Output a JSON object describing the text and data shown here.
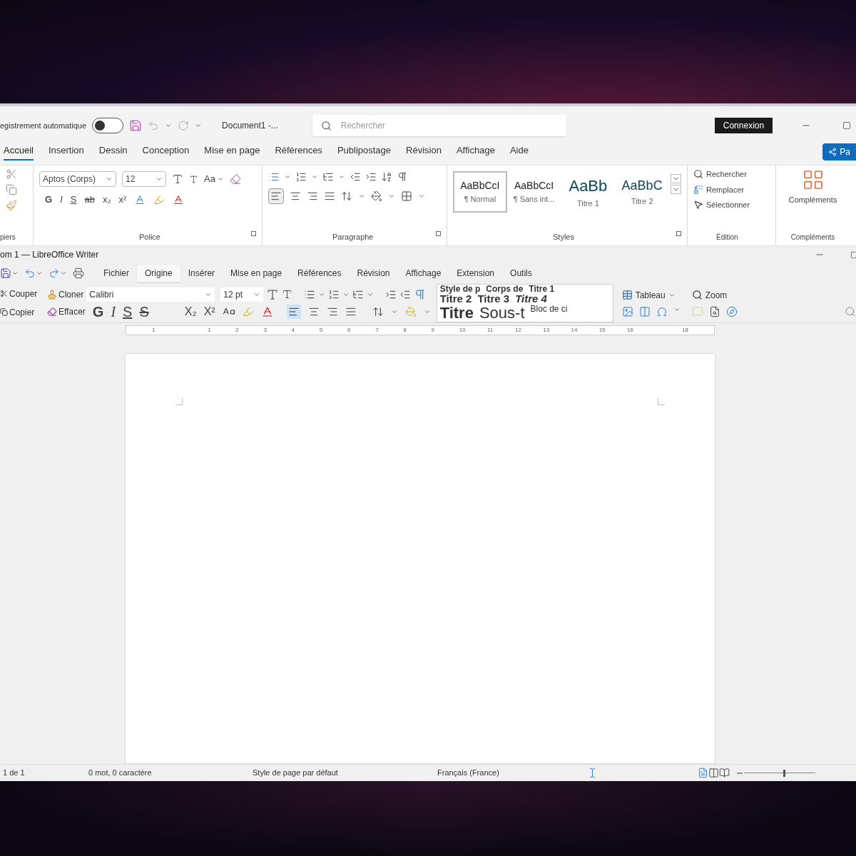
{
  "word": {
    "autosave_label": "egistrement automatique",
    "autosave_on": false,
    "doc_title": "Document1 -...",
    "search_placeholder": "Rechercher",
    "signin": "Connexion",
    "tabs": [
      {
        "label": "Accueil",
        "selected": true
      },
      {
        "label": "Insertion",
        "selected": false
      },
      {
        "label": "Dessin",
        "selected": false
      },
      {
        "label": "Conception",
        "selected": false
      },
      {
        "label": "Mise en page",
        "selected": false
      },
      {
        "label": "Références",
        "selected": false
      },
      {
        "label": "Publipostage",
        "selected": false
      },
      {
        "label": "Révision",
        "selected": false
      },
      {
        "label": "Affichage",
        "selected": false
      },
      {
        "label": "Aide",
        "selected": false
      }
    ],
    "share": "Pa",
    "font": "Aptos (Corps)",
    "size": "12",
    "case_button": "Aa",
    "format_chars": [
      "G",
      "I",
      "S",
      "ab",
      "x₂",
      "x²"
    ],
    "styles": [
      {
        "preview": "AaBbCcI",
        "name": "¶ Normal",
        "kind": "body",
        "selected": true
      },
      {
        "preview": "AaBbCcI",
        "name": "¶ Sans int...",
        "kind": "body",
        "selected": false
      },
      {
        "preview": "AaBb",
        "name": "Titre 1",
        "kind": "heading1",
        "selected": false
      },
      {
        "preview": "AaBbC",
        "name": "Titre 2",
        "kind": "heading2",
        "selected": false
      }
    ],
    "edit": [
      "Rechercher",
      "Remplacer",
      "Sélectionner"
    ],
    "addins": "Compléments",
    "groups": [
      "piers",
      "Police",
      "Paragraphe",
      "Styles",
      "Édition",
      "Compléments"
    ]
  },
  "writer": {
    "title": "om 1 — LibreOffice Writer",
    "menus": [
      {
        "label": "Fichier",
        "selected": false
      },
      {
        "label": "Origine",
        "selected": true
      },
      {
        "label": "Insérer",
        "selected": false
      },
      {
        "label": "Mise en page",
        "selected": false
      },
      {
        "label": "Références",
        "selected": false
      },
      {
        "label": "Révision",
        "selected": false
      },
      {
        "label": "Affichage",
        "selected": false
      },
      {
        "label": "Extension",
        "selected": false
      },
      {
        "label": "Outils",
        "selected": false
      }
    ],
    "cut": "Couper",
    "copy": "Copier",
    "clone": "Cloner",
    "clear": "Effacer",
    "font": "Calibri",
    "size": "12 pt",
    "format_chars": [
      "G",
      "I",
      "S",
      "S",
      "X₂",
      "X²"
    ],
    "style_rows": [
      [
        "Style de p",
        "Corps de",
        "Titre 1"
      ],
      [
        "Titre 2",
        "Titre 3",
        "Titre 4"
      ],
      [
        "Titre",
        "Sous-t",
        "Bloc de ci"
      ]
    ],
    "table": "Tableau",
    "zoom": "Zoom",
    "ruler": [
      "1",
      "1",
      "2",
      "3",
      "4",
      "5",
      "6",
      "7",
      "8",
      "9",
      "10",
      "11",
      "12",
      "13",
      "14",
      "15",
      "16",
      "18"
    ],
    "status": [
      "1 de 1",
      "0 mot, 0 caractère",
      "Style de page par défaut",
      "Français (France)"
    ],
    "zoom_slider": {
      "level": 0.55
    }
  }
}
